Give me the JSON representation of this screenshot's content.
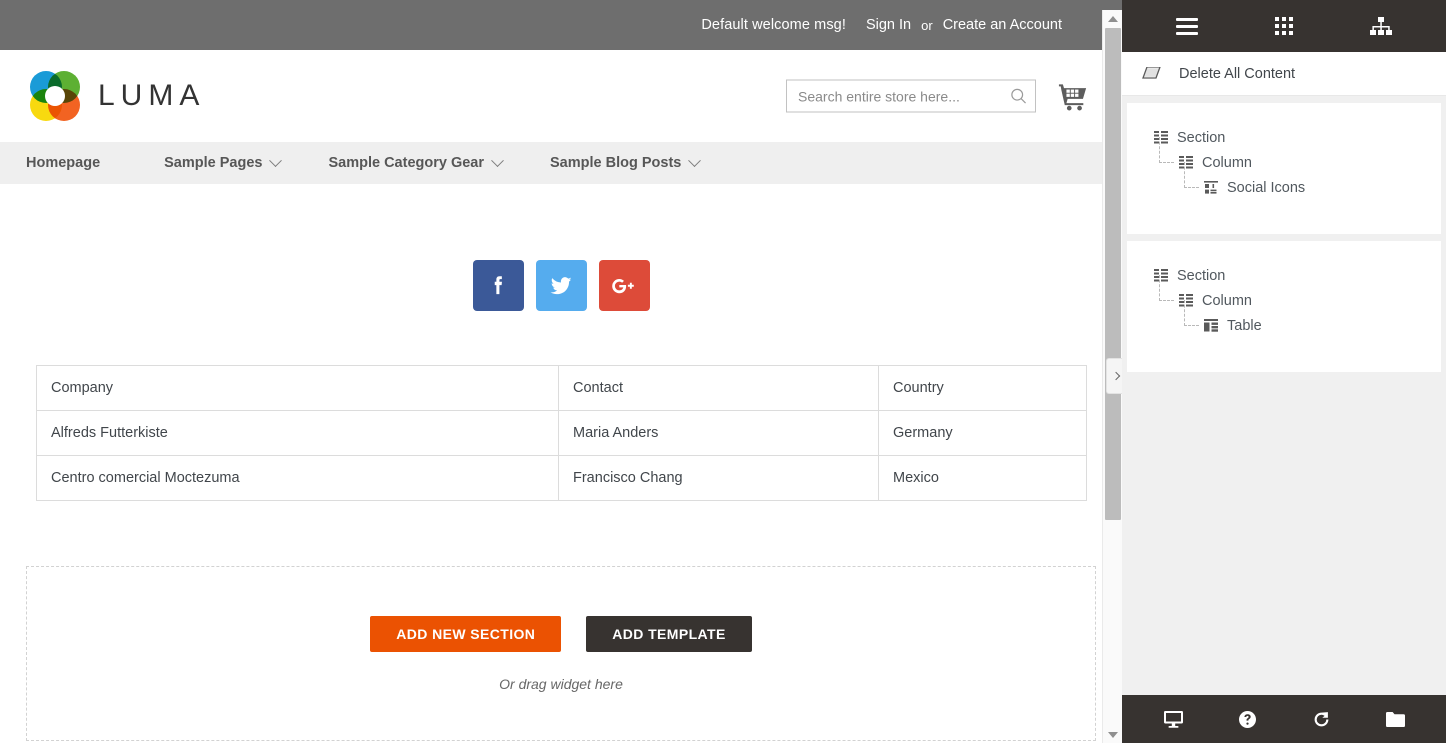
{
  "storefront": {
    "topbar": {
      "welcome": "Default welcome msg!",
      "sign_in": "Sign In",
      "or": "or",
      "create_account": "Create an Account"
    },
    "header": {
      "logo_text": "LUMA",
      "search_placeholder": "Search entire store here...",
      "search_value": "",
      "search_icon": "search-icon",
      "cart_icon": "shopping-cart-icon"
    },
    "nav": [
      {
        "label": "Homepage",
        "has_dropdown": false
      },
      {
        "label": "Sample Pages",
        "has_dropdown": true
      },
      {
        "label": "Sample Category Gear",
        "has_dropdown": true
      },
      {
        "label": "Sample Blog Posts",
        "has_dropdown": true
      }
    ],
    "social": [
      {
        "name": "facebook",
        "icon": "facebook-icon",
        "color": "#3b5998"
      },
      {
        "name": "twitter",
        "icon": "twitter-icon",
        "color": "#55acee"
      },
      {
        "name": "google-plus",
        "icon": "google-plus-icon",
        "color": "#dd4b39"
      }
    ],
    "table": {
      "headers": [
        "Company",
        "Contact",
        "Country"
      ],
      "rows": [
        [
          "Alfreds Futterkiste",
          "Maria Anders",
          "Germany"
        ],
        [
          "Centro comercial Moctezuma",
          "Francisco Chang",
          "Mexico"
        ]
      ]
    },
    "dropzone": {
      "add_section_label": "ADD NEW SECTION",
      "add_template_label": "ADD TEMPLATE",
      "hint": "Or drag widget here",
      "add_section_color": "#eb5202",
      "add_template_color": "#373330"
    },
    "collapse_handle_icon": "chevron-right-icon"
  },
  "builder": {
    "toolbar": [
      {
        "icon": "hamburger-menu-icon",
        "name": "menu"
      },
      {
        "icon": "grid-icon",
        "name": "grid"
      },
      {
        "icon": "sitemap-icon",
        "name": "structure"
      }
    ],
    "delete_all": {
      "label": "Delete All Content",
      "icon": "eraser-icon"
    },
    "tree": [
      {
        "nodes": [
          {
            "label": "Section",
            "icon": "section-icon",
            "level": 1
          },
          {
            "label": "Column",
            "icon": "column-icon",
            "level": 2
          },
          {
            "label": "Social Icons",
            "icon": "social-icons-icon",
            "level": 3
          }
        ]
      },
      {
        "nodes": [
          {
            "label": "Section",
            "icon": "section-icon",
            "level": 1
          },
          {
            "label": "Column",
            "icon": "column-icon",
            "level": 2
          },
          {
            "label": "Table",
            "icon": "table-icon",
            "level": 3
          }
        ]
      }
    ],
    "footer": [
      {
        "icon": "desktop-icon",
        "name": "viewport"
      },
      {
        "icon": "help-icon",
        "name": "help"
      },
      {
        "icon": "history-icon",
        "name": "history"
      },
      {
        "icon": "folder-icon",
        "name": "templates"
      }
    ]
  }
}
